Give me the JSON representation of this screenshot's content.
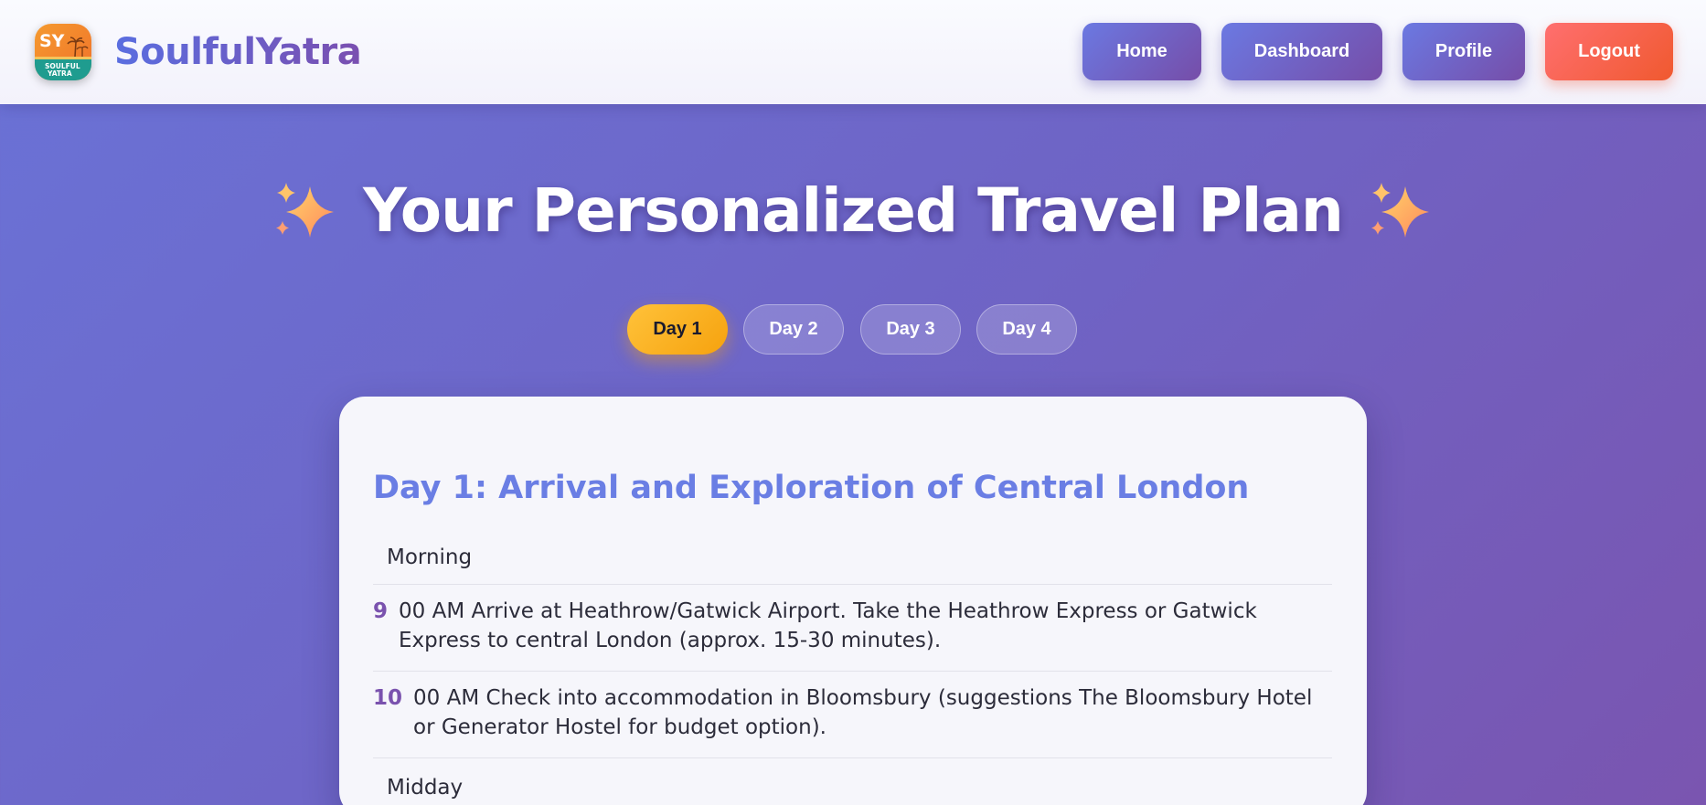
{
  "header": {
    "logo": {
      "initials": "SY",
      "sub_text": "SOULFUL",
      "sub_text_2": "YATRA",
      "icon": "travel-logo-icon"
    },
    "brand": "SoulfulYatra",
    "nav": [
      {
        "label": "Home"
      },
      {
        "label": "Dashboard"
      },
      {
        "label": "Profile"
      },
      {
        "label": "Logout"
      }
    ]
  },
  "main": {
    "title": "Your Personalized Travel Plan",
    "title_icon": "sparkles-icon",
    "tabs": [
      {
        "label": "Day 1",
        "active": true
      },
      {
        "label": "Day 2",
        "active": false
      },
      {
        "label": "Day 3",
        "active": false
      },
      {
        "label": "Day 4",
        "active": false
      }
    ],
    "day": {
      "heading": "Day 1: Arrival and Exploration of Central London",
      "sections": [
        {
          "label": "Morning",
          "items": [
            {
              "num": "9",
              "text": "00 AM Arrive at Heathrow/Gatwick Airport. Take the Heathrow Express or Gatwick Express to central London (approx. 15-30 minutes)."
            },
            {
              "num": "10",
              "text": "00 AM Check into accommodation in Bloomsbury (suggestions The Bloomsbury Hotel or Generator Hostel for budget option)."
            }
          ]
        },
        {
          "label": "Midday",
          "items": []
        }
      ]
    }
  },
  "colors": {
    "background_start": "#6a72d6",
    "background_end": "#7a55b0",
    "accent_purple": "#6b79e2",
    "logout_red": "#ff6f6f",
    "active_tab_gold": "#ffc23a",
    "heading_blue": "#6a7ee4",
    "item_number_purple": "#7a52ae"
  }
}
